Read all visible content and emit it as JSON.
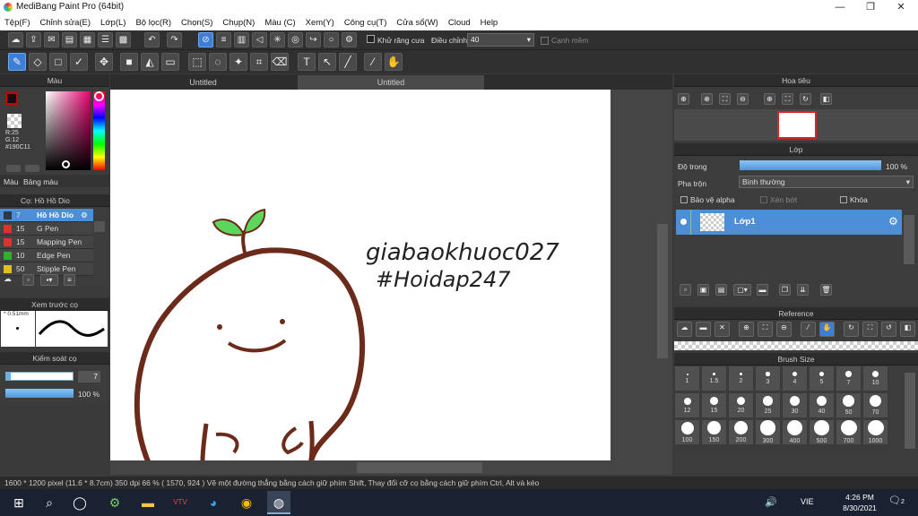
{
  "window": {
    "title": "MediBang Paint Pro (64bit)",
    "min": "—",
    "max": "❐",
    "close": "✕"
  },
  "menu": [
    "Tệp(F)",
    "Chỉnh sửa(E)",
    "Lớp(L)",
    "Bộ lọc(R)",
    "Chọn(S)",
    "Chụp(N)",
    "Màu (C)",
    "Xem(Y)",
    "Công cụ(T)",
    "Cửa sổ(W)",
    "Cloud",
    "Help"
  ],
  "toolbar1": {
    "antialias_label": "Khử răng cưa",
    "correction_label": "Điều chỉnh",
    "correction_value": "40",
    "snap_label": "Cạnh mềm"
  },
  "tabs": {
    "left": "Untitled",
    "right": "Untitled"
  },
  "color_panel": {
    "title": "Màu",
    "r": "R:25",
    "g": "G:12",
    "hex": "#190C11",
    "tab1": "Màu",
    "tab2": "Bảng màu",
    "primary": "#190c11",
    "secondary": "#ffffff"
  },
  "brush_panel": {
    "title": "Cọ: Hồ Hồ Dio",
    "items": [
      {
        "size": "7",
        "name": "Hồ Hồ Dio",
        "color": "#2a3a4a",
        "selected": true
      },
      {
        "size": "15",
        "name": "G Pen",
        "color": "#e03030",
        "selected": false
      },
      {
        "size": "15",
        "name": "Mapping Pen",
        "color": "#e03030",
        "selected": false
      },
      {
        "size": "10",
        "name": "Edge Pen",
        "color": "#30b030",
        "selected": false
      },
      {
        "size": "50",
        "name": "Stipple Pen",
        "color": "#e0c020",
        "selected": false
      }
    ]
  },
  "preview_panel": {
    "title": "Xem trước cọ",
    "size": "0.51mm"
  },
  "control_panel": {
    "title": "Kiểm soát cọ",
    "size_value": "7",
    "opacity_value": "100 %"
  },
  "navigator": {
    "title": "Hoa tiêu"
  },
  "layer_panel": {
    "title": "Lớp",
    "opacity_label": "Độ trong",
    "opacity_value": "100 %",
    "blend_label": "Pha trộn",
    "blend_value": "Bình thường",
    "protect_alpha": "Bảo vệ alpha",
    "clipping": "Xén bớt",
    "lock": "Khóa",
    "layer_name": "Lớp1"
  },
  "reference": {
    "title": "Reference"
  },
  "brush_size": {
    "title": "Brush Size",
    "sizes": [
      "1",
      "1.5",
      "2",
      "3",
      "4",
      "5",
      "7",
      "10",
      "12",
      "15",
      "20",
      "25",
      "30",
      "40",
      "50",
      "70",
      "100",
      "150",
      "200",
      "300",
      "400",
      "500",
      "700",
      "1000"
    ]
  },
  "canvas": {
    "text_line1": "giabaokhuoc027",
    "text_line2": "#Hoidap247"
  },
  "status": "1600 * 1200 pixel   (11.6 * 8.7cm)   350 dpi   66 %   ( 1570, 924 )   Vẽ một đường thẳng bằng cách giữ phím Shift, Thay đổi cỡ cọ bằng cách giữ phím Ctrl, Alt và kéo",
  "taskbar": {
    "lang": "VIE",
    "time": "4:26 PM",
    "date": "8/30/2021",
    "notif": "2"
  }
}
